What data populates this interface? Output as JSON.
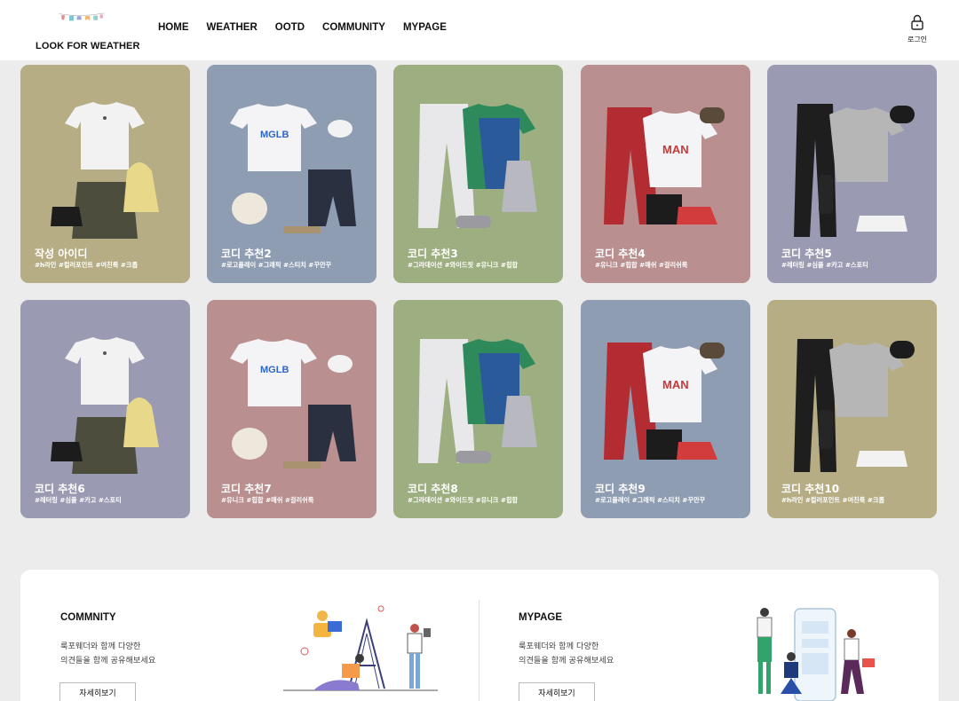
{
  "header": {
    "logo_text": "LOOK FOR WEATHER",
    "nav": [
      "HOME",
      "WEATHER",
      "OOTD",
      "COMMUNITY",
      "MYPAGE"
    ],
    "login_label": "로그인"
  },
  "cards": [
    {
      "title": "작성 아이디",
      "tags": "#h라인 #컬러포인트 #여친룩 #크롭",
      "bg": "#b7ad85"
    },
    {
      "title": "코디 추천2",
      "tags": "#로고플레이 #그래픽 #스티치 #꾸안꾸",
      "bg": "#8f9db3"
    },
    {
      "title": "코디 추천3",
      "tags": "#그라데이션 #와이드핏 #유니크 #힙합",
      "bg": "#9daf80"
    },
    {
      "title": "코디 추천4",
      "tags": "#유니크 #힙합 #매쉬 #걸리쉬룩",
      "bg": "#b98f8f"
    },
    {
      "title": "코디 추천5",
      "tags": "#레터링 #심플 #카고 #스포티",
      "bg": "#9b9ab3"
    },
    {
      "title": "코디 추천6",
      "tags": "#레터링 #심플 #카고 #스포티",
      "bg": "#9b9ab3"
    },
    {
      "title": "코디 추천7",
      "tags": "#유니크 #힙합 #매쉬 #걸리쉬룩",
      "bg": "#b98f8f"
    },
    {
      "title": "코디 추천8",
      "tags": "#그라데이션 #와이드핏 #유니크 #힙합",
      "bg": "#9daf80"
    },
    {
      "title": "코디 추천9",
      "tags": "#로고플레이 #그래픽 #스티치 #꾸안꾸",
      "bg": "#8f9db3"
    },
    {
      "title": "코디 추천10",
      "tags": "#h라인 #컬러포인트 #여친룩 #크롭",
      "bg": "#b7ad85"
    }
  ],
  "community": {
    "title": "COMMNITY",
    "desc_line1": "룩포웨더와 함께 다양한",
    "desc_line2": "의견들을 함께 공유해보세요",
    "button": "자세히보기"
  },
  "mypage": {
    "title": "MYPAGE",
    "desc_line1": "룩포웨더와 함께 다양한",
    "desc_line2": "의견들을 함께 공유해보세요",
    "button": "자세히보기"
  }
}
